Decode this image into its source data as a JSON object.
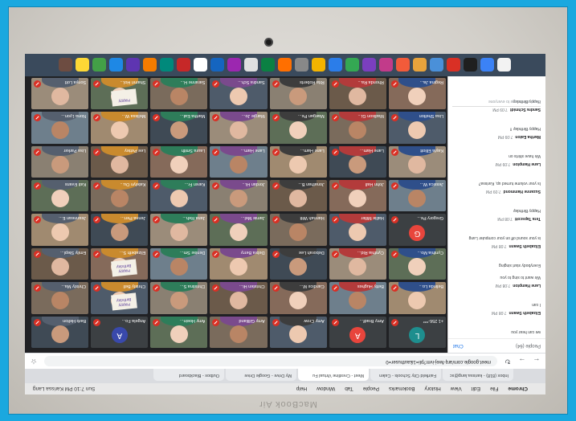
{
  "device": {
    "brand_text": "MacBook Air"
  },
  "menubar": {
    "items": [
      "Chrome",
      "File",
      "Edit",
      "View",
      "History",
      "Bookmarks",
      "People",
      "Tab",
      "Window",
      "Help"
    ],
    "status": "Sun 7:10 PM  Karissa Lang"
  },
  "browser": {
    "tabs": [
      {
        "label": "Inbox (818) - karissa.lang@sc",
        "active": false
      },
      {
        "label": "Fairfield City Schools - Calen",
        "active": false
      },
      {
        "label": "Meet - Crestline Virtual Fu",
        "active": true
      },
      {
        "label": "My Drive - Google Drive",
        "active": false
      },
      {
        "label": "Outbox - Blackboard",
        "active": false
      }
    ],
    "url": "meet.google.com/arq-fwej-ivm?pli=1&authuser=0"
  },
  "chat": {
    "tab_label": "Chat",
    "people_label": "People (64)",
    "messages": [
      {
        "who": "",
        "time": "",
        "text": "we can hear you"
      },
      {
        "who": "Elizabeth Swann",
        "time": "7:08 PM",
        "text": "I can"
      },
      {
        "who": "Lane Hampton",
        "time": "7:08 PM",
        "text": "We want to sing to you"
      },
      {
        "who": "",
        "time": "",
        "text": "Everybody start singing"
      },
      {
        "who": "Elizabeth Swann",
        "time": "7:08 PM",
        "text": "is your sound off on your computer Lang"
      },
      {
        "who": "Tera Tapscott",
        "time": "7:08 PM",
        "text": "Happy Birthday"
      },
      {
        "who": "Suzanne Hammond",
        "time": "7:09 PM",
        "text": "Is your volume turned up, Karissa?"
      },
      {
        "who": "Lane Hampton",
        "time": "7:09 PM",
        "text": "We have shirts on"
      },
      {
        "who": "Martha Eaton",
        "time": "7:09 PM",
        "text": "Happy Birthday !!"
      },
      {
        "who": "Sandra Schmidt",
        "time": "7:09 PM",
        "text": "Happy Birthday"
      }
    ],
    "input_placeholder": "Send a message to everyone"
  },
  "participants": [
    {
      "name": "+1 256-***",
      "kind": "avatar",
      "initial": "L",
      "color": "#1e8e8e"
    },
    {
      "name": "Amy Bradf...",
      "kind": "avatar",
      "initial": "A",
      "color": "#e8453c"
    },
    {
      "name": "Amy Crow",
      "kind": "video"
    },
    {
      "name": "Amy Gilliland",
      "kind": "video"
    },
    {
      "name": "Amy Hoein...",
      "kind": "video"
    },
    {
      "name": "Angela Fo...",
      "kind": "avatar",
      "initial": "A",
      "color": "#3949ab"
    },
    {
      "name": "Barb Helton",
      "kind": "video"
    },
    {
      "name": "Belinda Lo...",
      "kind": "video"
    },
    {
      "name": "Betty Hughes",
      "kind": "video"
    },
    {
      "name": "Candice M...",
      "kind": "video"
    },
    {
      "name": "Christen Hi...",
      "kind": "video"
    },
    {
      "name": "Christina S...",
      "kind": "video"
    },
    {
      "name": "Christy Bell",
      "kind": "sign",
      "sign": "Happy Birthday"
    },
    {
      "name": "Christy Ma...",
      "kind": "video"
    },
    {
      "name": "Cynthia Mo...",
      "kind": "video"
    },
    {
      "name": "Cynthia Rid...",
      "kind": "video"
    },
    {
      "name": "Deborah Lee",
      "kind": "video"
    },
    {
      "name": "Debra Berry",
      "kind": "video"
    },
    {
      "name": "Denise Sm...",
      "kind": "video"
    },
    {
      "name": "Elizabeth S...",
      "kind": "sign",
      "sign": "Happy Birthday"
    },
    {
      "name": "Emily Stepl...",
      "kind": "video"
    },
    {
      "name": "Gregory Pe...",
      "kind": "avatar",
      "initial": "G",
      "color": "#e8453c"
    },
    {
      "name": "Hallie Miller",
      "kind": "video"
    },
    {
      "name": "Hannah Witt",
      "kind": "video"
    },
    {
      "name": "Jamie Mel...",
      "kind": "video"
    },
    {
      "name": "Jana Reh...",
      "kind": "video"
    },
    {
      "name": "Jenna Perr...",
      "kind": "video"
    },
    {
      "name": "Jeannean E...",
      "kind": "video"
    },
    {
      "name": "Jessica W...",
      "kind": "video"
    },
    {
      "name": "John Hall",
      "kind": "video"
    },
    {
      "name": "Jonathan B...",
      "kind": "video"
    },
    {
      "name": "Jordan Hi...",
      "kind": "video"
    },
    {
      "name": "Karen Fr...",
      "kind": "video"
    },
    {
      "name": "Katelyn Ou...",
      "kind": "video"
    },
    {
      "name": "Kati Evans",
      "kind": "video"
    },
    {
      "name": "Kayla Elliott",
      "kind": "video"
    },
    {
      "name": "Lane Ham...",
      "kind": "video"
    },
    {
      "name": "Lane Ham...",
      "kind": "video"
    },
    {
      "name": "Lane Ham...",
      "kind": "video"
    },
    {
      "name": "Laura Smith",
      "kind": "video"
    },
    {
      "name": "Lee Pettey",
      "kind": "video"
    },
    {
      "name": "Lisa Parker",
      "kind": "video"
    },
    {
      "name": "Lisa Shelton",
      "kind": "video"
    },
    {
      "name": "Madison Gi...",
      "kind": "video"
    },
    {
      "name": "Maegan Pe...",
      "kind": "video"
    },
    {
      "name": "Margie Jo...",
      "kind": "video"
    },
    {
      "name": "Martha Eat...",
      "kind": "video"
    },
    {
      "name": "Melissa W...",
      "kind": "video"
    },
    {
      "name": "Nona Lyon...",
      "kind": "video"
    },
    {
      "name": "Regina Ja...",
      "kind": "video"
    },
    {
      "name": "Rhonda Ra...",
      "kind": "video"
    },
    {
      "name": "Rita Roberts",
      "kind": "video"
    },
    {
      "name": "Sandra Sch...",
      "kind": "video"
    },
    {
      "name": "Saranne H...",
      "kind": "video"
    },
    {
      "name": "Shamri Hol...",
      "kind": "sign",
      "sign": "Happy"
    },
    {
      "name": "Sonya Lott",
      "kind": "video"
    },
    {
      "name": "Sophie Gail...",
      "kind": "video"
    },
    {
      "name": "Stacie McD...",
      "kind": "video"
    },
    {
      "name": "Stacy Drake",
      "kind": "video"
    },
    {
      "name": "Susan Lewis",
      "kind": "video"
    },
    {
      "name": "Tawanna B...",
      "kind": "sign",
      "sign": "Happy Birthday"
    },
    {
      "name": "Tera Tapsc...",
      "kind": "avatar",
      "initial": "T",
      "color": "#2e7d32"
    },
    {
      "name": "Terri Pruitt",
      "kind": "video"
    }
  ]
}
